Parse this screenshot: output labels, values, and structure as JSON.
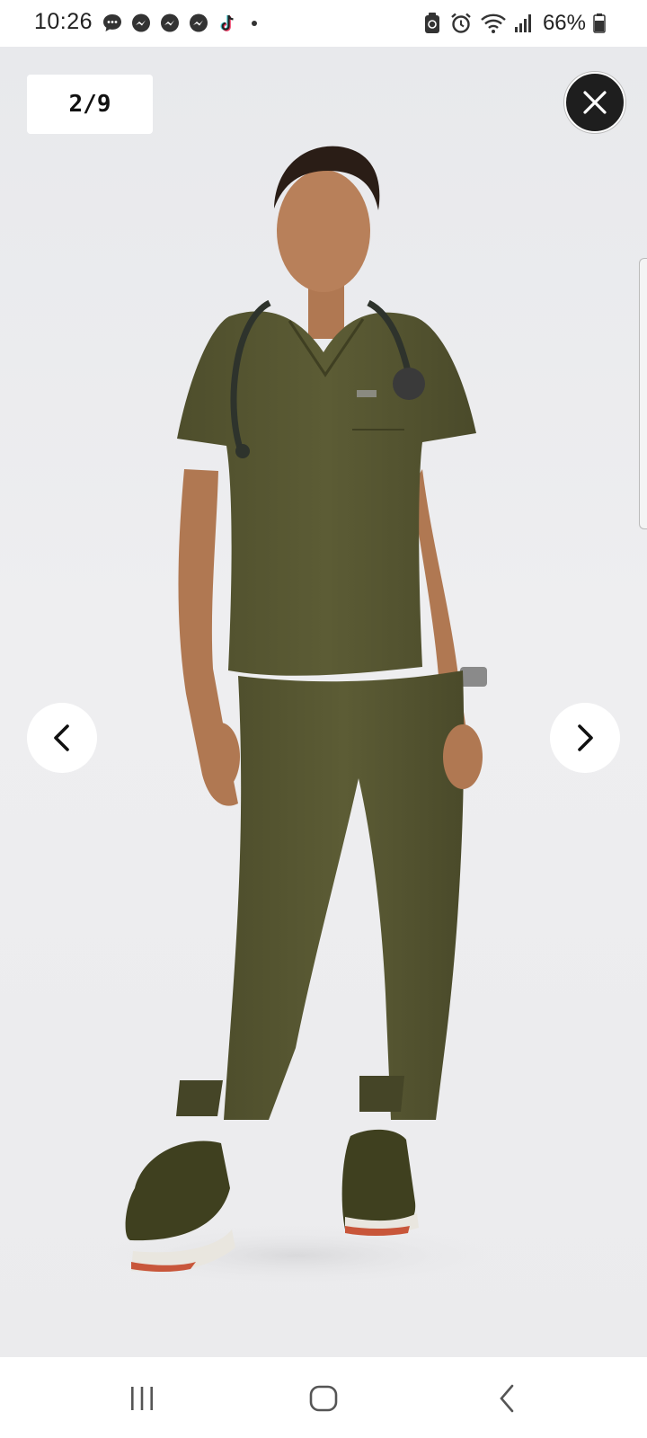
{
  "status_bar": {
    "time": "10:26",
    "notification_icons": [
      "chat-bubble-icon",
      "messenger-icon",
      "messenger-icon",
      "messenger-icon",
      "tiktok-icon"
    ],
    "battery_percent": "66%"
  },
  "gallery": {
    "counter": "2/9",
    "image_description_icon": "product-photo-olive-scrubs"
  },
  "colors": {
    "scrub_olive": "#5a5a33",
    "close_button": "#1e1e1e",
    "background": "#ececee"
  }
}
